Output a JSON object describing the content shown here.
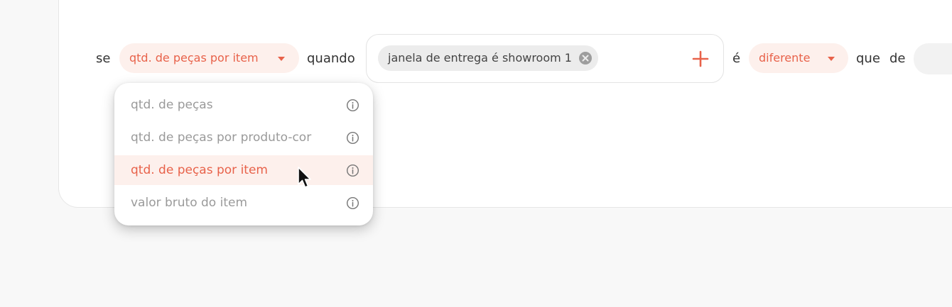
{
  "rule": {
    "prefix": "se",
    "metric_selected": "qtd. de peças por item",
    "when_label": "quando",
    "condition_chip": "janela de entrega é showroom 1",
    "is_label": "é",
    "comparator_selected": "diferente",
    "that_label": "que",
    "of_label": "de"
  },
  "dropdown": {
    "items": [
      {
        "label": "qtd. de peças"
      },
      {
        "label": "qtd. de peças por produto-cor"
      },
      {
        "label": "qtd. de peças por item"
      },
      {
        "label": "valor bruto do item"
      }
    ]
  },
  "icons": {
    "caret": "chevron-down-icon",
    "chip_remove": "close-circle-icon",
    "add": "plus-icon",
    "info": "info-icon",
    "cursor": "mouse-pointer-icon"
  },
  "colors": {
    "accent": "#e8624a",
    "accent_bg": "#fdf0ec",
    "chip_bg": "#ececec",
    "text": "#333333",
    "muted": "#9a9a9a"
  }
}
